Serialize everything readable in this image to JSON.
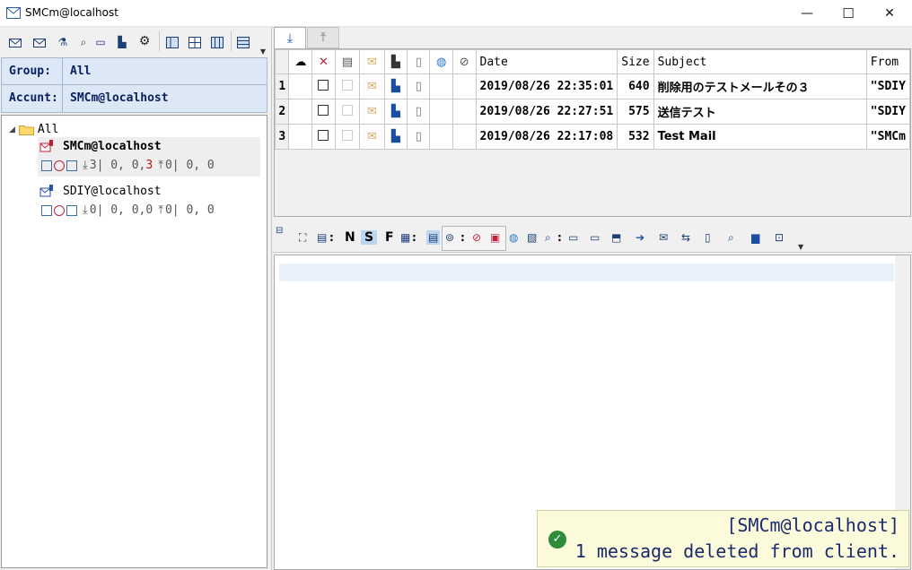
{
  "window": {
    "title": "SMCm@localhost",
    "min": "—",
    "max": "☐",
    "close": "✕"
  },
  "left_toolbar": {
    "icons": [
      "receive-icon",
      "send-receive-icon",
      "filter-icon",
      "search-icon",
      "save-icon",
      "gear-icon",
      "layout-icon",
      "layout-icon",
      "layout-icon",
      "list-icon"
    ]
  },
  "info": {
    "group_label": "Group:",
    "group_value": "All",
    "account_label": "Accunt:",
    "account_value": "SMCm@localhost"
  },
  "tree": {
    "root": "All",
    "accounts": [
      {
        "name": "SMCm@localhost",
        "s1": "3",
        "s2": "0, 0, ",
        "s3": "3",
        "s4": "0",
        "s5": "0, 0"
      },
      {
        "name": "SDIY@localhost",
        "s1": "0",
        "s2": "0, 0, ",
        "s3": "0",
        "s4": "0",
        "s5": "0, 0"
      }
    ]
  },
  "tabs": {
    "download": "download",
    "upload": "upload"
  },
  "mail_list": {
    "headers": {
      "date": "Date",
      "size": "Size",
      "subject": "Subject",
      "from": "From"
    },
    "rows": [
      {
        "n": "1",
        "date": "2019/08/26 22:35:01",
        "size": "640",
        "subject": "削除用のテストメールその３",
        "from": "\"SDIY"
      },
      {
        "n": "2",
        "date": "2019/08/26 22:27:51",
        "size": "575",
        "subject": "送信テスト",
        "from": "\"SDIY"
      },
      {
        "n": "3",
        "date": "2019/08/26 22:17:08",
        "size": "532",
        "subject": "Test Mail",
        "from": "\"SMCm"
      }
    ]
  },
  "viewer_toolbar": {
    "n": "N",
    "s": "S",
    "f": "F",
    "colon": ":"
  },
  "toast": {
    "line1": "[SMCm@localhost]",
    "line2": "1 message deleted from client."
  }
}
